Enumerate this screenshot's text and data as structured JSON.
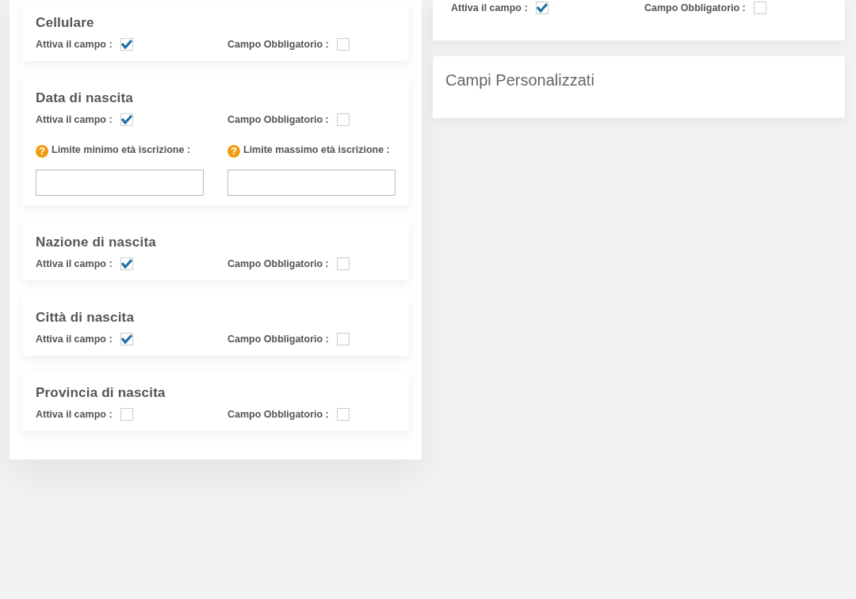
{
  "left_panel": {
    "sections": [
      {
        "title": "Cellulare",
        "options": [
          {
            "label": "Attiva il campo :",
            "checked": true
          },
          {
            "label": "Campo Obbligatorio :",
            "checked": false
          }
        ]
      },
      {
        "title": "Data di nascita",
        "options": [
          {
            "label": "Attiva il campo :",
            "checked": true
          },
          {
            "label": "Campo Obbligatorio :",
            "checked": false
          }
        ],
        "limits": [
          {
            "help": "?",
            "label": "Limite minimo età iscrizione :"
          },
          {
            "help": "?",
            "label": "Limite massimo età iscrizione :"
          }
        ]
      },
      {
        "title": "Nazione di nascita",
        "options": [
          {
            "label": "Attiva il campo :",
            "checked": true
          },
          {
            "label": "Campo Obbligatorio :",
            "checked": false
          }
        ]
      },
      {
        "title": "Città di nascita",
        "options": [
          {
            "label": "Attiva il campo :",
            "checked": true
          },
          {
            "label": "Campo Obbligatorio :",
            "checked": false
          }
        ]
      },
      {
        "title": "Provincia di nascita",
        "options": [
          {
            "label": "Attiva il campo :",
            "checked": false
          },
          {
            "label": "Campo Obbligatorio :",
            "checked": false
          }
        ]
      }
    ]
  },
  "right_panel": {
    "options": [
      {
        "label": "Attiva il campo :",
        "checked": true
      },
      {
        "label": "Campo Obbligatorio :",
        "checked": false
      }
    ],
    "custom_fields": {
      "title": "Campi Personalizzati"
    }
  }
}
